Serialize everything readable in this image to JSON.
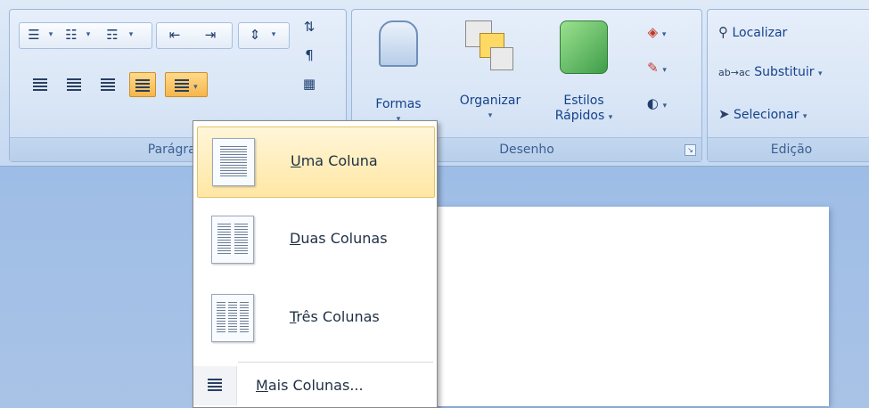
{
  "groups": {
    "paragraph": {
      "label": "Parágrafo"
    },
    "drawing": {
      "label": "Desenho"
    },
    "editing": {
      "label": "Edição"
    }
  },
  "drawing": {
    "shapes_label": "Formas",
    "arrange_label": "Organizar",
    "quick_styles_line1": "Estilos",
    "quick_styles_line2": "Rápidos"
  },
  "editing": {
    "find_label": "Localizar",
    "replace_label": "Substituir",
    "select_label": "Selecionar"
  },
  "columns_menu": {
    "items": [
      {
        "label": "Uma Coluna",
        "accel": "U",
        "rest": "ma Coluna",
        "highlighted": true
      },
      {
        "label": "Duas Colunas",
        "accel": "D",
        "rest": "uas Colunas"
      },
      {
        "label": "Três Colunas",
        "accel": "T",
        "rest": "rês Colunas"
      }
    ],
    "more": {
      "label": "Mais Colunas...",
      "accel": "M",
      "rest": "ais Colunas..."
    }
  },
  "colors": {
    "highlight": "#ffe7a4",
    "ribbon": "#d3e2f4",
    "workspace": "#a9c3e6",
    "text": "#15428b"
  }
}
